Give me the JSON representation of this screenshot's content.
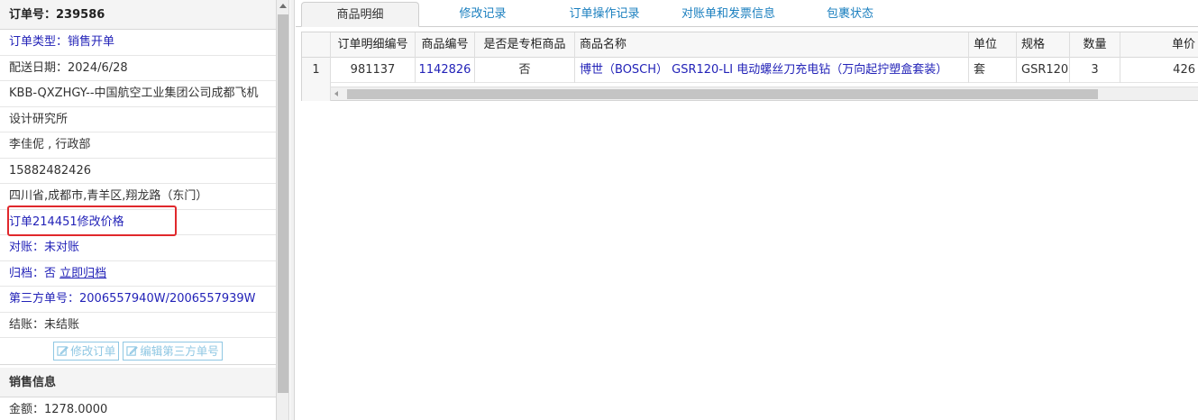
{
  "order": {
    "number_label": "订单号：",
    "number": "239586",
    "type_label": "订单类型：",
    "type_value": "销售开单",
    "delivery_date": "配送日期：2024/6/28",
    "customer_line1": "KBB-QXZHGY--中国航空工业集团公司成都飞机",
    "customer_line2": "设计研究所",
    "contact": "李佳伲 , 行政部",
    "phone": "15882482426",
    "address": "四川省,成都市,青羊区,翔龙路（东门）",
    "price_change_link": "订单214451修改价格",
    "reconcile_label": "对账：",
    "reconcile_value": "未对账",
    "archive_label": "归档：",
    "archive_value": "否",
    "archive_link": "立即归档",
    "third_party_label": "第三方单号：",
    "third_party_value": "2006557940W/2006557939W",
    "settle_label": "结账：",
    "settle_value": "未结账",
    "buttons": {
      "edit_order": "修改订单",
      "edit_third_party": "编辑第三方单号"
    }
  },
  "sales": {
    "section_title": "销售信息",
    "amount": "金额：1278.0000"
  },
  "tabs": [
    {
      "label": "商品明细",
      "active": true
    },
    {
      "label": "修改记录",
      "active": false
    },
    {
      "label": "订单操作记录",
      "active": false
    },
    {
      "label": "对账单和发票信息",
      "active": false
    },
    {
      "label": "包裹状态",
      "active": false
    }
  ],
  "table": {
    "headers": [
      "",
      "订单明细编号",
      "商品编号",
      "是否是专柜商品",
      "商品名称",
      "单位",
      "规格",
      "数量",
      "单价"
    ],
    "rows": [
      [
        "1",
        "981137",
        "1142826",
        "否",
        "博世（BOSCH） GSR120-LI 电动螺丝刀充电钻（万向起拧塑盒套装）",
        "套",
        "GSR120",
        "3",
        "426"
      ]
    ]
  },
  "colors": {
    "link_blue": "#2323b8",
    "tab_blue": "#1a7fbf",
    "highlight_red": "#e0282c",
    "button_border": "#8fc7e3"
  }
}
